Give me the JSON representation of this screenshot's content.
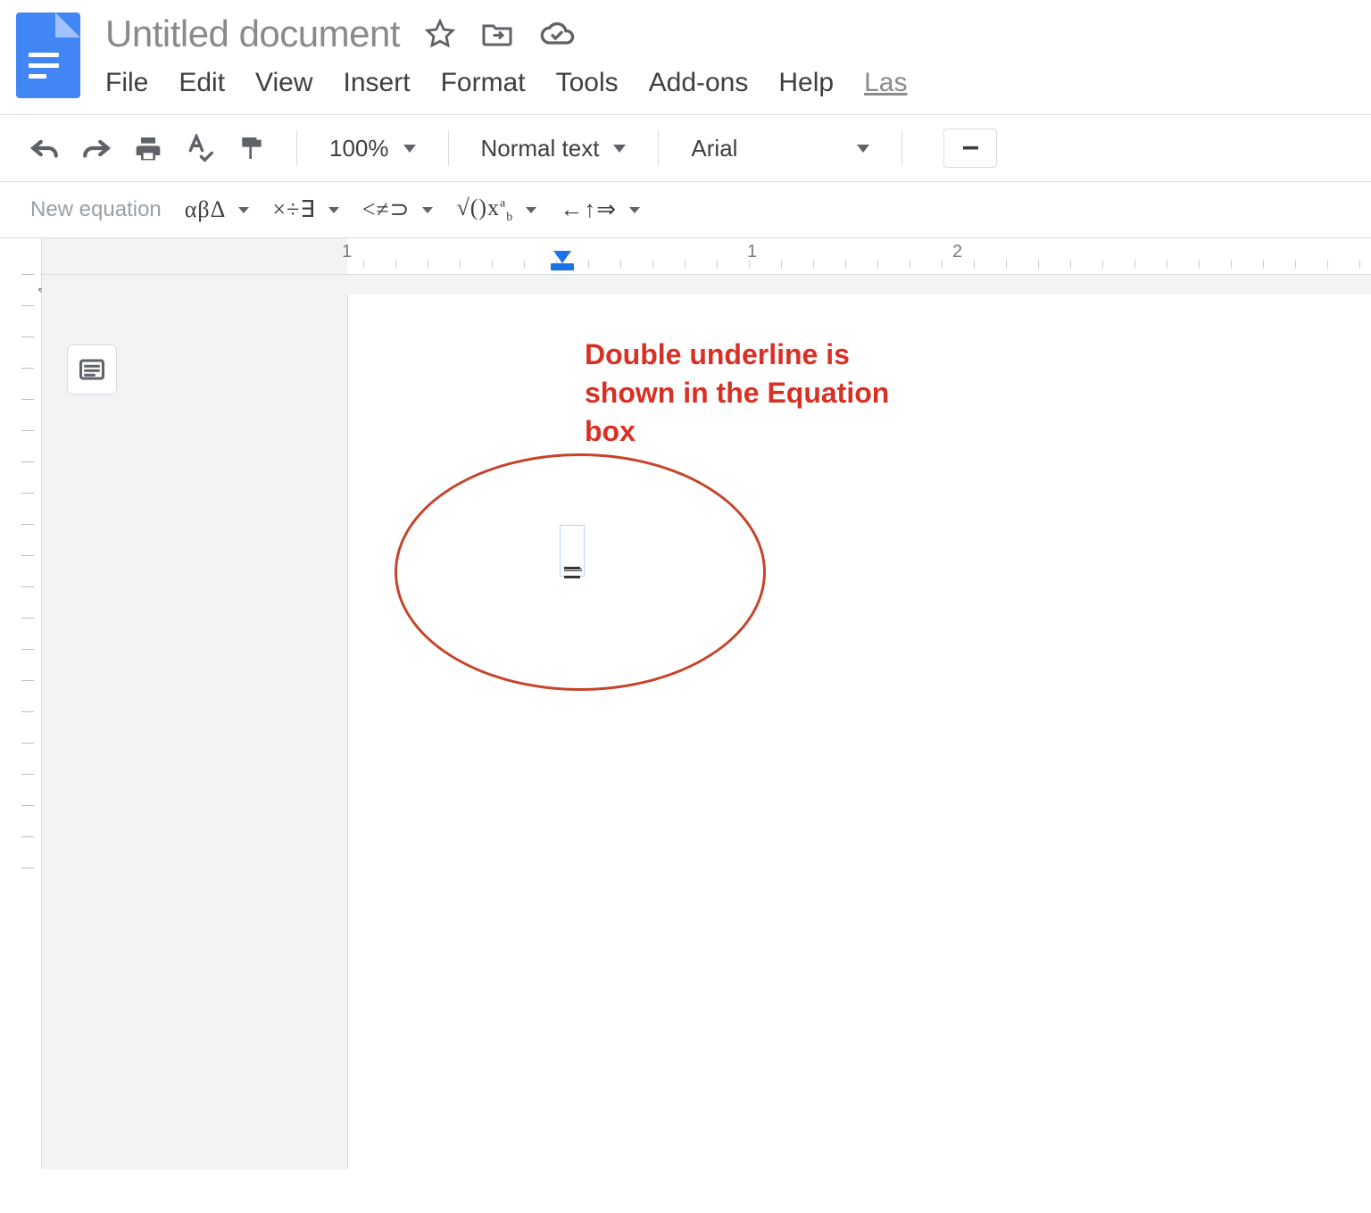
{
  "header": {
    "title": "Untitled document"
  },
  "menubar": {
    "items": [
      "File",
      "Edit",
      "View",
      "Insert",
      "Format",
      "Tools",
      "Add-ons",
      "Help"
    ],
    "last": "Las"
  },
  "toolbar": {
    "zoom": "100%",
    "style": "Normal text",
    "font": "Arial",
    "minus": "−"
  },
  "equation_toolbar": {
    "label": "New equation",
    "groups": {
      "greek": "αβΔ",
      "ops": "×÷∃",
      "rel": "<≠⊃",
      "misc": "√()x",
      "arrows": "←↑⇒"
    }
  },
  "ruler": {
    "left1": "1",
    "right1": "1",
    "right2": "2"
  },
  "annotation": {
    "line1": "Double underline is",
    "line2": "shown in the Equation",
    "line3": "box"
  }
}
